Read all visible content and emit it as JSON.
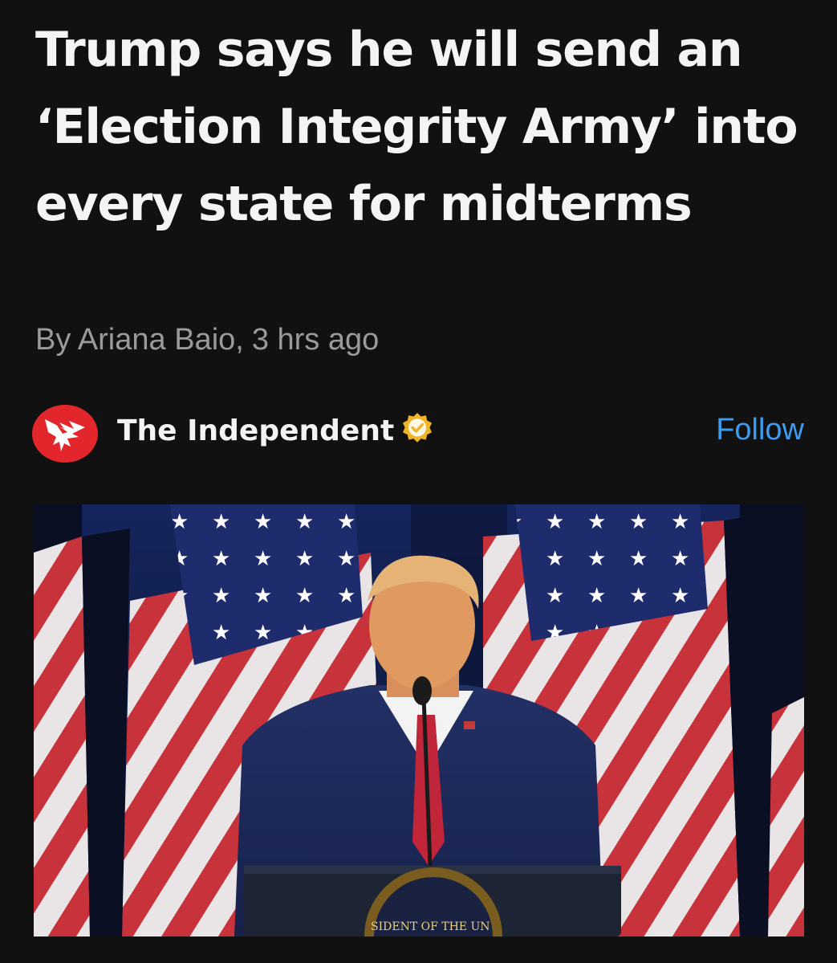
{
  "article": {
    "headline": "Trump says he will send an ‘Election Integrity Army’ into every state for midterms",
    "byline_author": "By Ariana Baio,",
    "byline_time": "3 hrs ago"
  },
  "publisher": {
    "name": "The Independent",
    "logo_icon": "eagle-icon",
    "verified_icon": "verified-badge-icon",
    "follow_label": "Follow",
    "brand_color": "#e3262b",
    "verified_color": "#f0b429",
    "follow_color": "#3d9bf0"
  },
  "photo": {
    "podium_seal_text": "SIDENT OF THE UN"
  }
}
